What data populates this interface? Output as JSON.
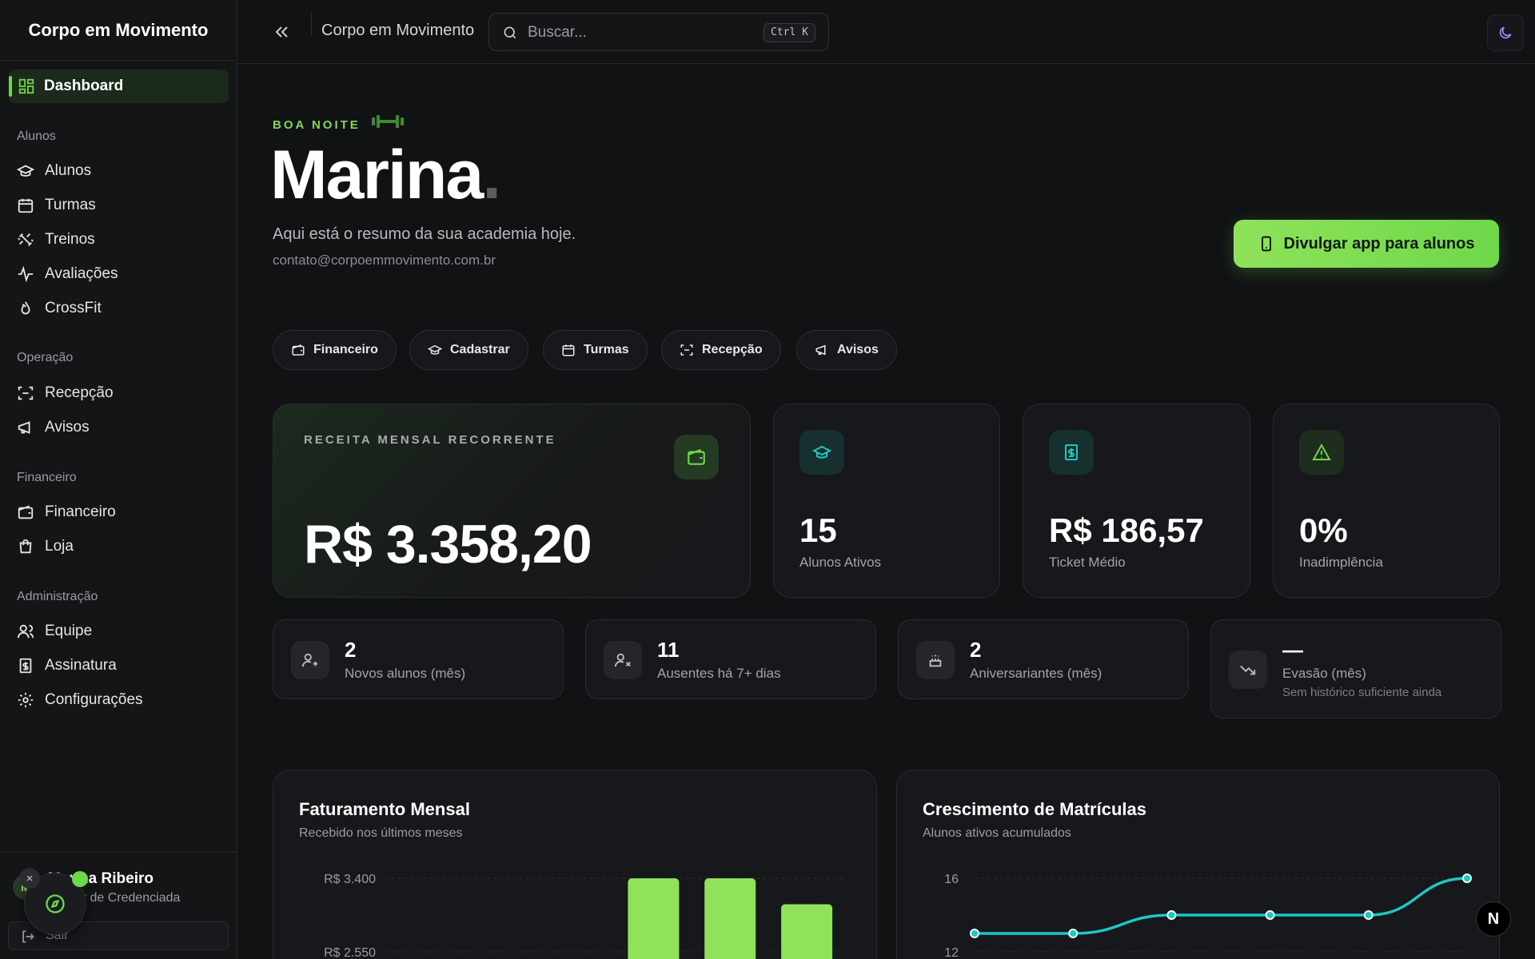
{
  "app": {
    "brand": "Corpo em Movimento"
  },
  "sidebar": {
    "active": {
      "label": "Dashboard"
    },
    "sections": [
      {
        "title": "Alunos",
        "items": [
          "Alunos",
          "Turmas",
          "Treinos",
          "Avaliações",
          "CrossFit"
        ]
      },
      {
        "title": "Operação",
        "items": [
          "Recepção",
          "Avisos"
        ]
      },
      {
        "title": "Financeiro",
        "items": [
          "Financeiro",
          "Loja"
        ]
      },
      {
        "title": "Administração",
        "items": [
          "Equipe",
          "Assinatura",
          "Configurações"
        ]
      }
    ],
    "user": {
      "initials": "M",
      "name": "Marina Ribeiro",
      "role": "Gestor de Credenciada",
      "logout": "Sair"
    }
  },
  "topbar": {
    "title": "Corpo em Movimento",
    "search_placeholder": "Buscar...",
    "shortcut": "Ctrl K"
  },
  "greeting": {
    "kicker": "BOA NOITE",
    "name": "Marina",
    "dot": ".",
    "subtitle": "Aqui está o resumo da sua academia hoje.",
    "email": "contato@corpoemmovimento.com.br",
    "cta": "Divulgar app para alunos"
  },
  "quick_actions": [
    "Financeiro",
    "Cadastrar",
    "Turmas",
    "Recepção",
    "Avisos"
  ],
  "kpis": {
    "mrr": {
      "label": "RECEITA MENSAL RECORRENTE",
      "value": "R$ 3.358,20"
    },
    "active_students": {
      "value": "15",
      "label": "Alunos Ativos"
    },
    "ticket": {
      "value": "R$ 186,57",
      "label": "Ticket Médio"
    },
    "default_rate": {
      "value": "0%",
      "label": "Inadimplência"
    }
  },
  "mini_stats": [
    {
      "value": "2",
      "label": "Novos alunos (mês)"
    },
    {
      "value": "11",
      "label": "Ausentes há 7+ dias"
    },
    {
      "value": "2",
      "label": "Aniversariantes (mês)"
    },
    {
      "value": "—",
      "label": "Evasão (mês)",
      "sub": "Sem histórico suficiente ainda"
    }
  ],
  "charts": {
    "revenue": {
      "title": "Faturamento Mensal",
      "subtitle": "Recebido nos últimos meses",
      "ticks": [
        "R$ 3.400",
        "R$ 2.550"
      ]
    },
    "growth": {
      "title": "Crescimento de Matrículas",
      "subtitle": "Alunos ativos acumulados",
      "ticks": [
        "16",
        "12"
      ]
    }
  },
  "chart_data": [
    {
      "type": "bar",
      "title": "Faturamento Mensal",
      "categories": [
        "",
        "",
        "",
        "",
        "",
        ""
      ],
      "values": [
        0,
        0,
        0,
        3400,
        3400,
        3100
      ],
      "ylim": [
        0,
        3400
      ],
      "grid": true
    },
    {
      "type": "line",
      "title": "Crescimento de Matrículas",
      "x": [
        1,
        2,
        3,
        4,
        5,
        6
      ],
      "values": [
        13,
        13,
        14,
        14,
        14,
        16
      ],
      "ylim": [
        12,
        16
      ],
      "grid": true
    }
  ],
  "colors": {
    "accent": "#6fd84a",
    "teal": "#1fc7c2",
    "background": "#111214"
  }
}
